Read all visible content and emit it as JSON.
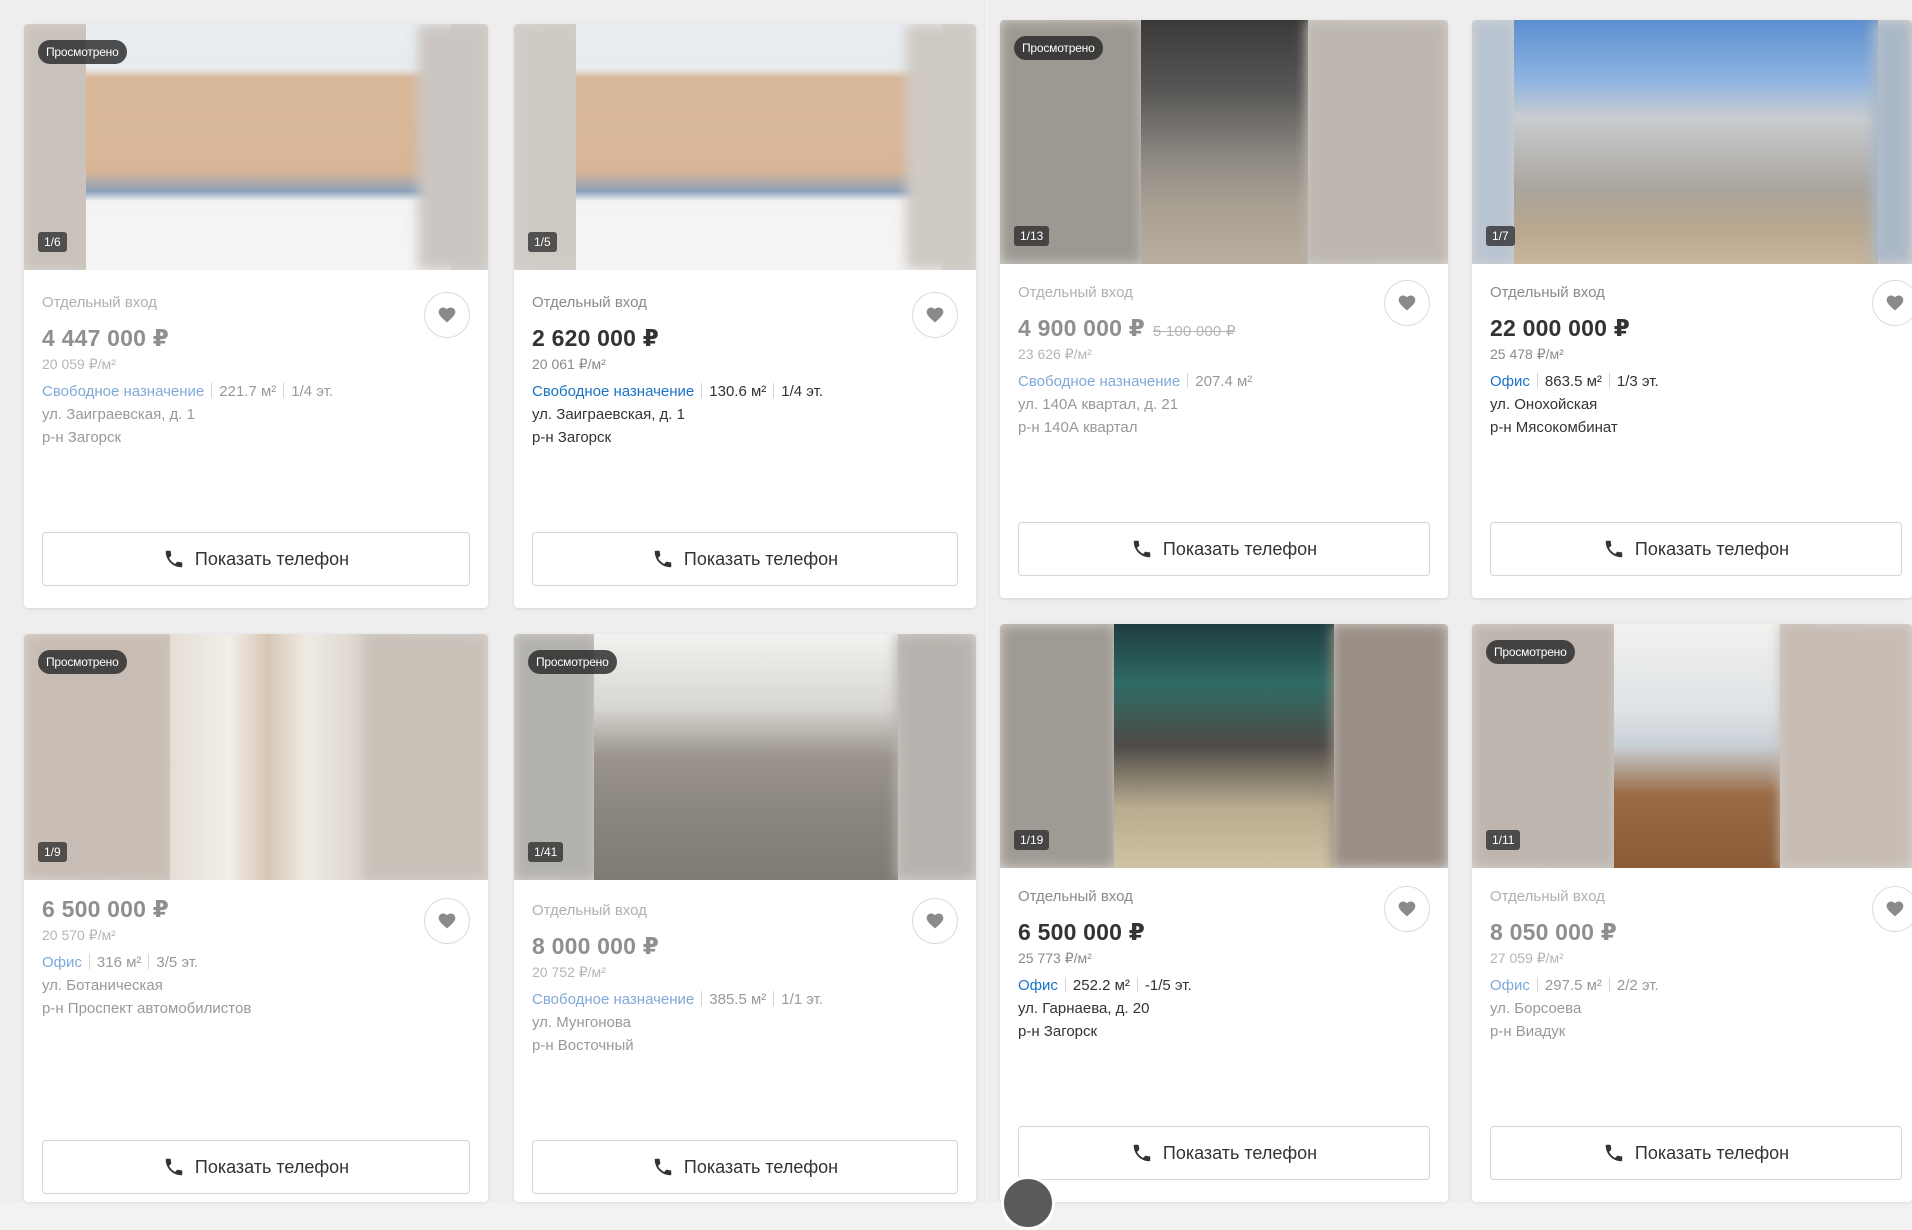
{
  "ui": {
    "favorite_icon": "heart-icon",
    "phone_icon": "phone-icon"
  },
  "cards": [
    {
      "badge": "Просмотрено",
      "counter": "1/6",
      "entrance": "Отдельный вход",
      "price": "4 447 000 ₽",
      "old_price": "",
      "price_per_m2": "20 059 ₽/м²",
      "type": "Свободное назначение",
      "area": "221.7 м²",
      "floor": "1/4 эт.",
      "address": "ул. Заиграевская, д. 1",
      "district": "р-н Загорск",
      "phone_label": "Показать телефон"
    },
    {
      "badge": "",
      "counter": "1/5",
      "entrance": "Отдельный вход",
      "price": "2 620 000 ₽",
      "old_price": "",
      "price_per_m2": "20 061 ₽/м²",
      "type": "Свободное назначение",
      "area": "130.6 м²",
      "floor": "1/4 эт.",
      "address": "ул. Заиграевская, д. 1",
      "district": "р-н Загорск",
      "phone_label": "Показать телефон"
    },
    {
      "badge": "Просмотрено",
      "counter": "1/13",
      "entrance": "Отдельный вход",
      "price": "4 900 000 ₽",
      "old_price": "5 100 000 ₽",
      "price_per_m2": "23 626 ₽/м²",
      "type": "Свободное назначение",
      "area": "207.4 м²",
      "floor": "",
      "address": "ул. 140А квартал, д. 21",
      "district": "р-н 140А квартал",
      "phone_label": "Показать телефон"
    },
    {
      "badge": "",
      "counter": "1/7",
      "entrance": "Отдельный вход",
      "price": "22 000 000 ₽",
      "old_price": "",
      "price_per_m2": "25 478 ₽/м²",
      "type": "Офис",
      "area": "863.5 м²",
      "floor": "1/3 эт.",
      "address": "ул. Онохойская",
      "district": "р-н Мясокомбинат",
      "phone_label": "Показать телефон"
    },
    {
      "badge": "Просмотрено",
      "counter": "1/9",
      "entrance": "",
      "price": "6 500 000 ₽",
      "old_price": "",
      "price_per_m2": "20 570 ₽/м²",
      "type": "Офис",
      "area": "316 м²",
      "floor": "3/5 эт.",
      "address": "ул. Ботаническая",
      "district": "р-н Проспект автомобилистов",
      "phone_label": "Показать телефон"
    },
    {
      "badge": "Просмотрено",
      "counter": "1/41",
      "entrance": "Отдельный вход",
      "price": "8 000 000 ₽",
      "old_price": "",
      "price_per_m2": "20 752 ₽/м²",
      "type": "Свободное назначение",
      "area": "385.5 м²",
      "floor": "1/1 эт.",
      "address": "ул. Мунгонова",
      "district": "р-н Восточный",
      "phone_label": "Показать телефон"
    },
    {
      "badge": "",
      "counter": "1/19",
      "entrance": "Отдельный вход",
      "price": "6 500 000 ₽",
      "old_price": "",
      "price_per_m2": "25 773 ₽/м²",
      "type": "Офис",
      "area": "252.2 м²",
      "floor": "-1/5 эт.",
      "address": "ул. Гарнаева, д. 20",
      "district": "р-н Загорск",
      "phone_label": "Показать телефон"
    },
    {
      "badge": "Просмотрено",
      "counter": "1/11",
      "entrance": "Отдельный вход",
      "price": "8 050 000 ₽",
      "old_price": "",
      "price_per_m2": "27 059 ₽/м²",
      "type": "Офис",
      "area": "297.5 м²",
      "floor": "2/2 эт.",
      "address": "ул. Борсоева",
      "district": "р-н Виадук",
      "phone_label": "Показать телефон"
    }
  ]
}
